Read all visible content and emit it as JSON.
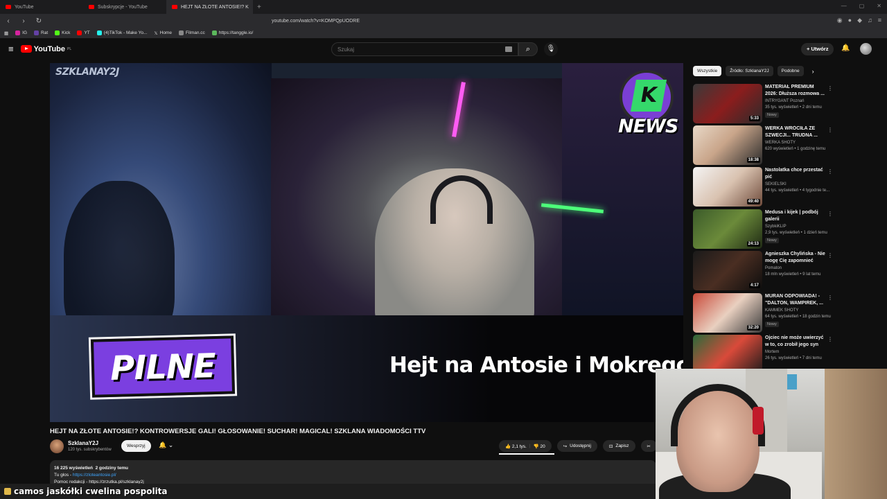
{
  "browser": {
    "tabs": [
      {
        "label": "YouTube"
      },
      {
        "label": "Subskrypcje - YouTube"
      },
      {
        "label": "HEJT NA ZŁOTE ANTOSIE!? K"
      }
    ],
    "url": "youtube.com/watch?v=KOMPQpUODRE",
    "bookmarks": [
      "IG",
      "Rat",
      "Kick",
      "YT",
      "(4)TikTok - Make Yo...",
      "Home",
      "Filman.cc",
      "https://tanggle.io/"
    ]
  },
  "masthead": {
    "logo": "YouTube",
    "logo_region": "PL",
    "search_placeholder": "Szukaj",
    "create_label": "Utwórz"
  },
  "video": {
    "watermark": "SZKLANAY2J",
    "news_badge": "NEWS",
    "pilne": "PILNE",
    "headline": "Hejt na Antosie i MokregoSucha"
  },
  "watch": {
    "title": "HEJT NA ZŁOTE ANTOSIE!? KONTROWERSJE GALI! GŁOSOWANIE! SUCHAR! MAGICAL! SZKLANA WIADOMOŚCI TTV",
    "channel": "SzklanaY2J",
    "subscribers": "120 tys. subskrybentów",
    "support_label": "Wesprzyj",
    "likes": "2,1 tys.",
    "comments": "20",
    "share_label": "Udostępnij",
    "save_label": "Zapisz",
    "views": "16 225 wyświetleń",
    "age": "2 godziny temu",
    "desc_line": "Tu głos - ",
    "desc_link": "https://zloteantosie.pl/",
    "desc_line2": "Pomoc redakcji - https://zrzutka.pl/szklanay2j"
  },
  "chat": {
    "text": "camos jaskółki cwelina pospolita"
  },
  "sidebar": {
    "chips": [
      "Wszystkie",
      "Źródło: SzklanaY2J",
      "Podobne"
    ],
    "items": [
      {
        "title": "MATERIAŁ PREMIUM 2026: Dłuższa rozmowa ...",
        "channel": "INTRYGANT Poznań",
        "views": "35 tys. wyświetleń • 2 dni temu",
        "badge": "Nowy",
        "duration": "5:33"
      },
      {
        "title": "WERKA WRÓCIŁA ZE SZWECJI... TRUDNA ...",
        "channel": "WERKA SHOTY",
        "views": "620 wyświetleń • 1 godzinę temu",
        "badge": "",
        "duration": "18:38"
      },
      {
        "title": "Nastolatka chce przestać pić",
        "channel": "SEKIELSKI",
        "views": "44 tys. wyświetleń • 4 tygodnie te...",
        "badge": "",
        "duration": "49:40"
      },
      {
        "title": "Medusa i kijek | podbój galerii",
        "channel": "SzybkiKLIP",
        "views": "2,9 tys. wyświetleń • 1 dzień temu",
        "badge": "Nowy",
        "duration": "24:13"
      },
      {
        "title": "Agnieszka Chylińska - Nie mogę Cię zapomnieć",
        "channel": "Pomaton",
        "views": "18 mln wyświetleń • 9 lat temu",
        "badge": "",
        "duration": "4:17"
      },
      {
        "title": "MURAN ODPOWIADA! - \"DALTON, WAMPIREK, ...",
        "channel": "KAMMEK SHOTY",
        "views": "64 tys. wyświetleń • 18 godzin temu",
        "badge": "Nowy",
        "duration": "32:20"
      },
      {
        "title": "Ojciec nie może uwierzyć w to, co zrobił jego syn",
        "channel": "Mortem",
        "views": "26 tys. wyświetleń • 7 dni temu",
        "badge": "",
        "duration": ""
      }
    ]
  },
  "colors": {
    "bg": "#0f0f0f",
    "brand_red": "#ff0000",
    "accent_purple": "#7b3fe0",
    "link": "#3ea6ff"
  }
}
